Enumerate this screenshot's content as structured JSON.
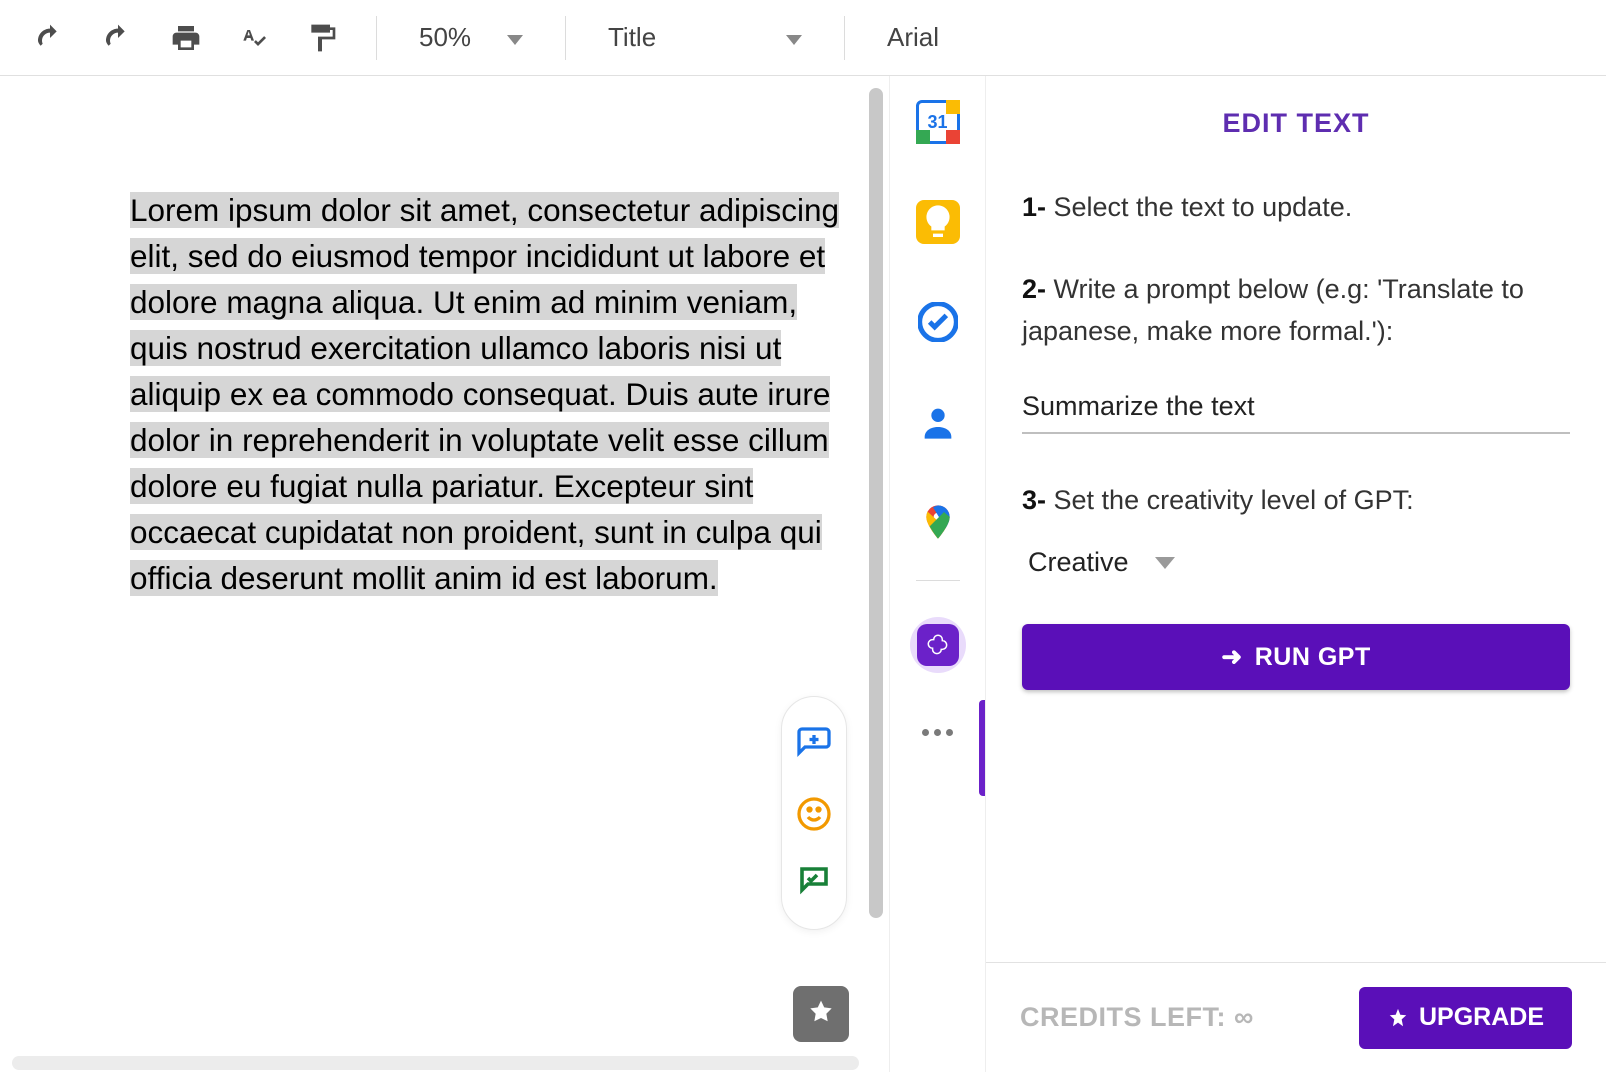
{
  "toolbar": {
    "zoom": "50%",
    "style": "Title",
    "font": "Arial"
  },
  "document": {
    "selected_text": "Lorem ipsum dolor sit amet, consectetur adipiscing elit, sed do eiusmod tempor incididunt ut labore et dolore magna aliqua. Ut enim ad minim veniam, quis nostrud exercitation ullamco laboris nisi ut aliquip ex ea commodo consequat. Duis aute irure dolor in reprehenderit in voluptate velit esse cillum dolore eu fugiat nulla pariatur. Excepteur sint occaecat cupidatat non proident, sunt in culpa qui officia deserunt mollit anim id est laborum."
  },
  "rail": {
    "calendar_day": "31"
  },
  "panel": {
    "title": "EDIT TEXT",
    "step1_num": "1-",
    "step1_text": " Select the text to update.",
    "step2_num": "2-",
    "step2_text": " Write a prompt below (e.g: 'Translate to japanese, make more formal.'):",
    "prompt_value": "Summarize the text",
    "step3_num": "3-",
    "step3_text": " Set the creativity level of GPT:",
    "creativity_value": "Creative",
    "run_label": "RUN GPT",
    "credits_label": "CREDITS LEFT: ∞",
    "upgrade_label": "UPGRADE"
  }
}
